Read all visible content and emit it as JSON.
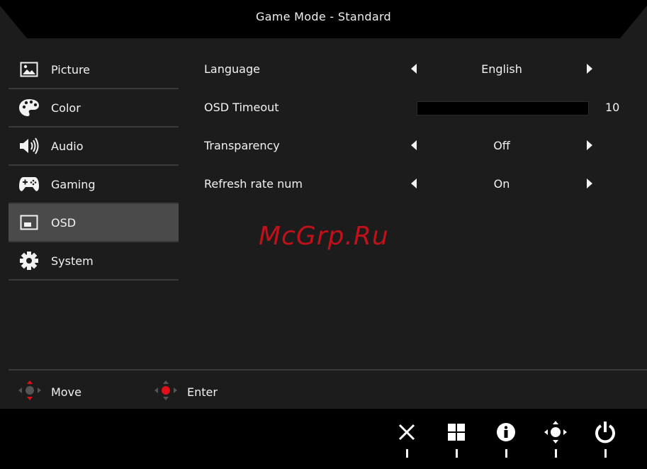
{
  "header": {
    "title": "Game Mode - Standard"
  },
  "sidebar": {
    "items": [
      {
        "label": "Picture",
        "icon": "picture-icon",
        "active": false
      },
      {
        "label": "Color",
        "icon": "palette-icon",
        "active": false
      },
      {
        "label": "Audio",
        "icon": "speaker-icon",
        "active": false
      },
      {
        "label": "Gaming",
        "icon": "gamepad-icon",
        "active": false
      },
      {
        "label": "OSD",
        "icon": "osd-icon",
        "active": true
      },
      {
        "label": "System",
        "icon": "gear-icon",
        "active": false
      }
    ]
  },
  "settings": {
    "language": {
      "label": "Language",
      "value": "English"
    },
    "osd_timeout": {
      "label": "OSD Timeout",
      "value": "10",
      "fraction": 0
    },
    "transparency": {
      "label": "Transparency",
      "value": "Off"
    },
    "refresh_rate_num": {
      "label": "Refresh rate num",
      "value": "On"
    }
  },
  "hints": {
    "move": {
      "label": "Move",
      "icon": "move-joystick-icon"
    },
    "enter": {
      "label": "Enter",
      "icon": "enter-joystick-icon"
    }
  },
  "watermark": "McGrp.Ru",
  "buttons": [
    {
      "icon": "close-icon"
    },
    {
      "icon": "grid-icon"
    },
    {
      "icon": "info-icon"
    },
    {
      "icon": "joystick-icon"
    },
    {
      "icon": "power-icon"
    }
  ],
  "colors": {
    "accent": "#e0101a",
    "panel": "#1c1c1c",
    "active_item": "#4a4a4a"
  }
}
